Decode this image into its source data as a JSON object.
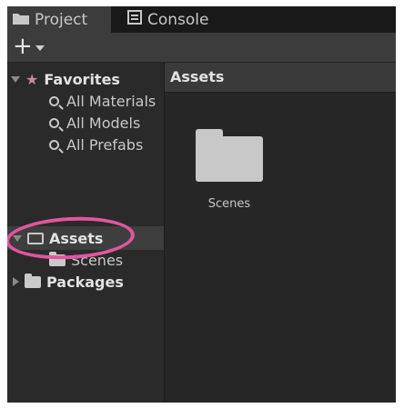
{
  "tabs": [
    {
      "label": "Project",
      "icon": "folder-icon"
    },
    {
      "label": "Console",
      "icon": "console-icon"
    }
  ],
  "toolbar": {
    "add_label": "+"
  },
  "sidebar": {
    "favorites_label": "Favorites",
    "favorites": [
      "All Materials",
      "All Models",
      "All Prefabs"
    ],
    "assets_label": "Assets",
    "assets_children": [
      "Scenes"
    ],
    "packages_label": "Packages"
  },
  "main": {
    "header": "Assets",
    "items": [
      {
        "label": "Scenes",
        "icon": "folder-icon"
      }
    ]
  },
  "colors": {
    "highlight_ring": "#e0569e",
    "favorites_star": "#c08aa8"
  }
}
